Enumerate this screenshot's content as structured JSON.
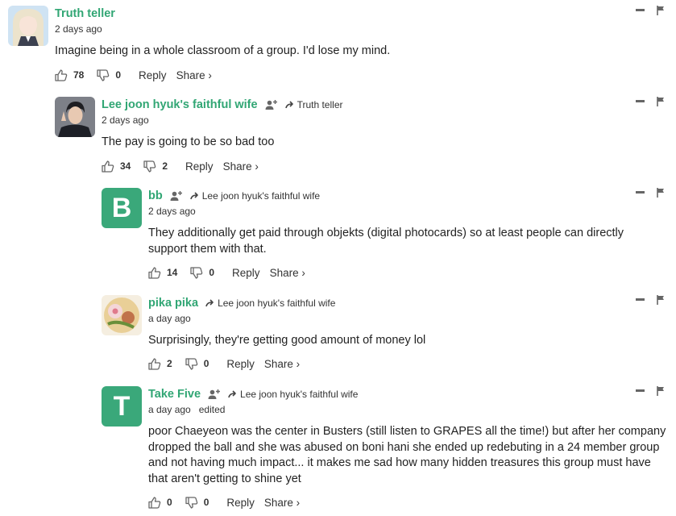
{
  "comments": [
    {
      "author": "Truth teller",
      "avatar": {
        "type": "photo",
        "desc": "doll-avatar"
      },
      "time": "2 days ago",
      "edited": "",
      "reply_to": "",
      "text": "Imagine being in a whole classroom of a group. I'd lose my mind.",
      "likes": "78",
      "dislikes": "0",
      "reply_label": "Reply",
      "share_label": "Share ›"
    },
    {
      "author": "Lee joon hyuk's faithful wife",
      "avatar": {
        "type": "photo",
        "desc": "man-avatar"
      },
      "time": "2 days ago",
      "edited": "",
      "reply_to": "Truth teller",
      "text": "The pay is going to be so bad too",
      "likes": "34",
      "dislikes": "2",
      "reply_label": "Reply",
      "share_label": "Share ›"
    },
    {
      "author": "bb",
      "avatar": {
        "type": "letter",
        "letter": "B"
      },
      "time": "2 days ago",
      "edited": "",
      "reply_to": "Lee joon hyuk's faithful wife",
      "text": "They additionally get paid through objekts (digital photocards) so at least people can directly support them with that.",
      "likes": "14",
      "dislikes": "0",
      "reply_label": "Reply",
      "share_label": "Share ›"
    },
    {
      "author": "pika pika",
      "avatar": {
        "type": "photo",
        "desc": "ramen-avatar"
      },
      "time": "a day ago",
      "edited": "",
      "reply_to": "Lee joon hyuk's faithful wife",
      "text": "Surprisingly, they're getting good amount of money lol",
      "likes": "2",
      "dislikes": "0",
      "reply_label": "Reply",
      "share_label": "Share ›"
    },
    {
      "author": "Take Five",
      "avatar": {
        "type": "letter",
        "letter": "T"
      },
      "time": "a day ago",
      "edited": "edited",
      "reply_to": "Lee joon hyuk's faithful wife",
      "text": "poor Chaeyeon was the center in Busters (still listen to GRAPES all the time!) but after her company dropped the ball and she was abused on boni hani she ended up redebuting in a 24 member group and not having much impact... it makes me sad how many hidden treasures this group must have that aren't getting to shine yet",
      "likes": "0",
      "dislikes": "0",
      "reply_label": "Reply",
      "share_label": "Share ›"
    }
  ],
  "colors": {
    "author": "#31a674",
    "letter_avatar": "#3aa87a",
    "icon": "#666666"
  },
  "icons": {
    "like": "thumbs-up-icon",
    "dislike": "thumbs-down-icon",
    "follow": "follow-user-icon",
    "reply_to": "reply-arrow-icon",
    "minimize": "minimize-icon",
    "flag": "flag-icon"
  }
}
